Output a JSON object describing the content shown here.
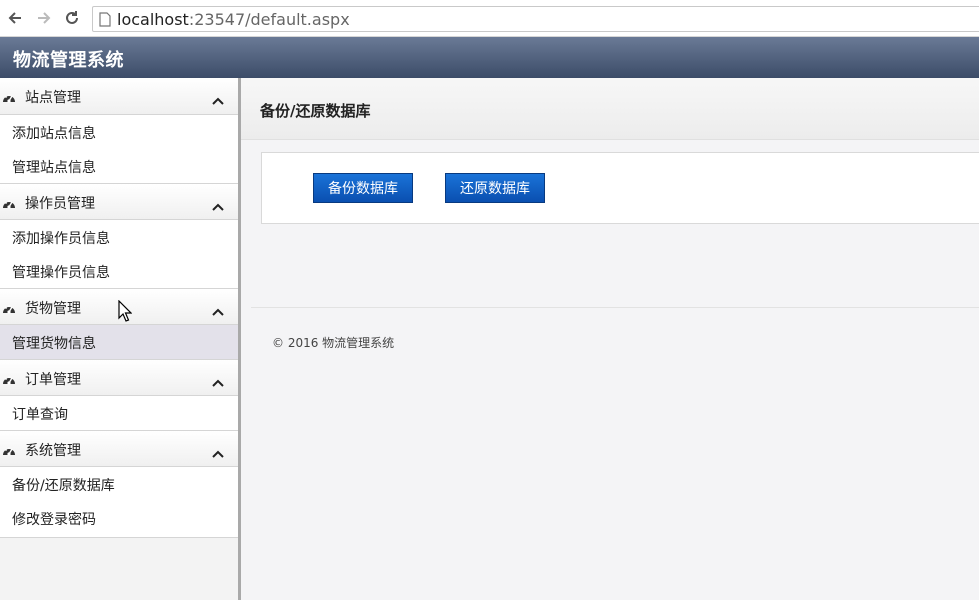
{
  "browser": {
    "url_host": "localhost",
    "url_rest": ":23547/default.aspx"
  },
  "app": {
    "title": "物流管理系统"
  },
  "sidebar": {
    "groups": [
      {
        "label": "站点管理",
        "items": [
          "添加站点信息",
          "管理站点信息"
        ]
      },
      {
        "label": "操作员管理",
        "items": [
          "添加操作员信息",
          "管理操作员信息"
        ]
      },
      {
        "label": "货物管理",
        "items": [
          "管理货物信息"
        ]
      },
      {
        "label": "订单管理",
        "items": [
          "订单查询"
        ]
      },
      {
        "label": "系统管理",
        "items": [
          "备份/还原数据库",
          "修改登录密码"
        ]
      }
    ]
  },
  "main": {
    "title": "备份/还原数据库",
    "backup_button": "备份数据库",
    "restore_button": "还原数据库",
    "footer": "© 2016 物流管理系统"
  },
  "colors": {
    "header": "#4a5a78",
    "button": "#0f5fc4"
  }
}
